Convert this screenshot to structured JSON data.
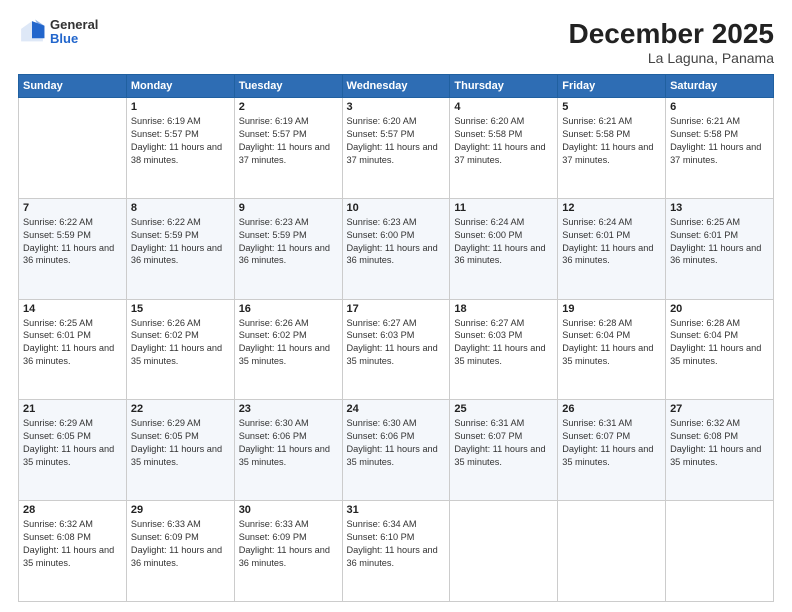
{
  "header": {
    "logo": {
      "line1": "General",
      "line2": "Blue"
    },
    "title": "December 2025",
    "subtitle": "La Laguna, Panama"
  },
  "weekdays": [
    "Sunday",
    "Monday",
    "Tuesday",
    "Wednesday",
    "Thursday",
    "Friday",
    "Saturday"
  ],
  "weeks": [
    [
      {
        "day": "",
        "sunrise": "",
        "sunset": "",
        "daylight": ""
      },
      {
        "day": "1",
        "sunrise": "6:19 AM",
        "sunset": "5:57 PM",
        "daylight": "11 hours and 38 minutes."
      },
      {
        "day": "2",
        "sunrise": "6:19 AM",
        "sunset": "5:57 PM",
        "daylight": "11 hours and 37 minutes."
      },
      {
        "day": "3",
        "sunrise": "6:20 AM",
        "sunset": "5:57 PM",
        "daylight": "11 hours and 37 minutes."
      },
      {
        "day": "4",
        "sunrise": "6:20 AM",
        "sunset": "5:58 PM",
        "daylight": "11 hours and 37 minutes."
      },
      {
        "day": "5",
        "sunrise": "6:21 AM",
        "sunset": "5:58 PM",
        "daylight": "11 hours and 37 minutes."
      },
      {
        "day": "6",
        "sunrise": "6:21 AM",
        "sunset": "5:58 PM",
        "daylight": "11 hours and 37 minutes."
      }
    ],
    [
      {
        "day": "7",
        "sunrise": "6:22 AM",
        "sunset": "5:59 PM",
        "daylight": "11 hours and 36 minutes."
      },
      {
        "day": "8",
        "sunrise": "6:22 AM",
        "sunset": "5:59 PM",
        "daylight": "11 hours and 36 minutes."
      },
      {
        "day": "9",
        "sunrise": "6:23 AM",
        "sunset": "5:59 PM",
        "daylight": "11 hours and 36 minutes."
      },
      {
        "day": "10",
        "sunrise": "6:23 AM",
        "sunset": "6:00 PM",
        "daylight": "11 hours and 36 minutes."
      },
      {
        "day": "11",
        "sunrise": "6:24 AM",
        "sunset": "6:00 PM",
        "daylight": "11 hours and 36 minutes."
      },
      {
        "day": "12",
        "sunrise": "6:24 AM",
        "sunset": "6:01 PM",
        "daylight": "11 hours and 36 minutes."
      },
      {
        "day": "13",
        "sunrise": "6:25 AM",
        "sunset": "6:01 PM",
        "daylight": "11 hours and 36 minutes."
      }
    ],
    [
      {
        "day": "14",
        "sunrise": "6:25 AM",
        "sunset": "6:01 PM",
        "daylight": "11 hours and 36 minutes."
      },
      {
        "day": "15",
        "sunrise": "6:26 AM",
        "sunset": "6:02 PM",
        "daylight": "11 hours and 35 minutes."
      },
      {
        "day": "16",
        "sunrise": "6:26 AM",
        "sunset": "6:02 PM",
        "daylight": "11 hours and 35 minutes."
      },
      {
        "day": "17",
        "sunrise": "6:27 AM",
        "sunset": "6:03 PM",
        "daylight": "11 hours and 35 minutes."
      },
      {
        "day": "18",
        "sunrise": "6:27 AM",
        "sunset": "6:03 PM",
        "daylight": "11 hours and 35 minutes."
      },
      {
        "day": "19",
        "sunrise": "6:28 AM",
        "sunset": "6:04 PM",
        "daylight": "11 hours and 35 minutes."
      },
      {
        "day": "20",
        "sunrise": "6:28 AM",
        "sunset": "6:04 PM",
        "daylight": "11 hours and 35 minutes."
      }
    ],
    [
      {
        "day": "21",
        "sunrise": "6:29 AM",
        "sunset": "6:05 PM",
        "daylight": "11 hours and 35 minutes."
      },
      {
        "day": "22",
        "sunrise": "6:29 AM",
        "sunset": "6:05 PM",
        "daylight": "11 hours and 35 minutes."
      },
      {
        "day": "23",
        "sunrise": "6:30 AM",
        "sunset": "6:06 PM",
        "daylight": "11 hours and 35 minutes."
      },
      {
        "day": "24",
        "sunrise": "6:30 AM",
        "sunset": "6:06 PM",
        "daylight": "11 hours and 35 minutes."
      },
      {
        "day": "25",
        "sunrise": "6:31 AM",
        "sunset": "6:07 PM",
        "daylight": "11 hours and 35 minutes."
      },
      {
        "day": "26",
        "sunrise": "6:31 AM",
        "sunset": "6:07 PM",
        "daylight": "11 hours and 35 minutes."
      },
      {
        "day": "27",
        "sunrise": "6:32 AM",
        "sunset": "6:08 PM",
        "daylight": "11 hours and 35 minutes."
      }
    ],
    [
      {
        "day": "28",
        "sunrise": "6:32 AM",
        "sunset": "6:08 PM",
        "daylight": "11 hours and 35 minutes."
      },
      {
        "day": "29",
        "sunrise": "6:33 AM",
        "sunset": "6:09 PM",
        "daylight": "11 hours and 36 minutes."
      },
      {
        "day": "30",
        "sunrise": "6:33 AM",
        "sunset": "6:09 PM",
        "daylight": "11 hours and 36 minutes."
      },
      {
        "day": "31",
        "sunrise": "6:34 AM",
        "sunset": "6:10 PM",
        "daylight": "11 hours and 36 minutes."
      },
      {
        "day": "",
        "sunrise": "",
        "sunset": "",
        "daylight": ""
      },
      {
        "day": "",
        "sunrise": "",
        "sunset": "",
        "daylight": ""
      },
      {
        "day": "",
        "sunrise": "",
        "sunset": "",
        "daylight": ""
      }
    ]
  ]
}
